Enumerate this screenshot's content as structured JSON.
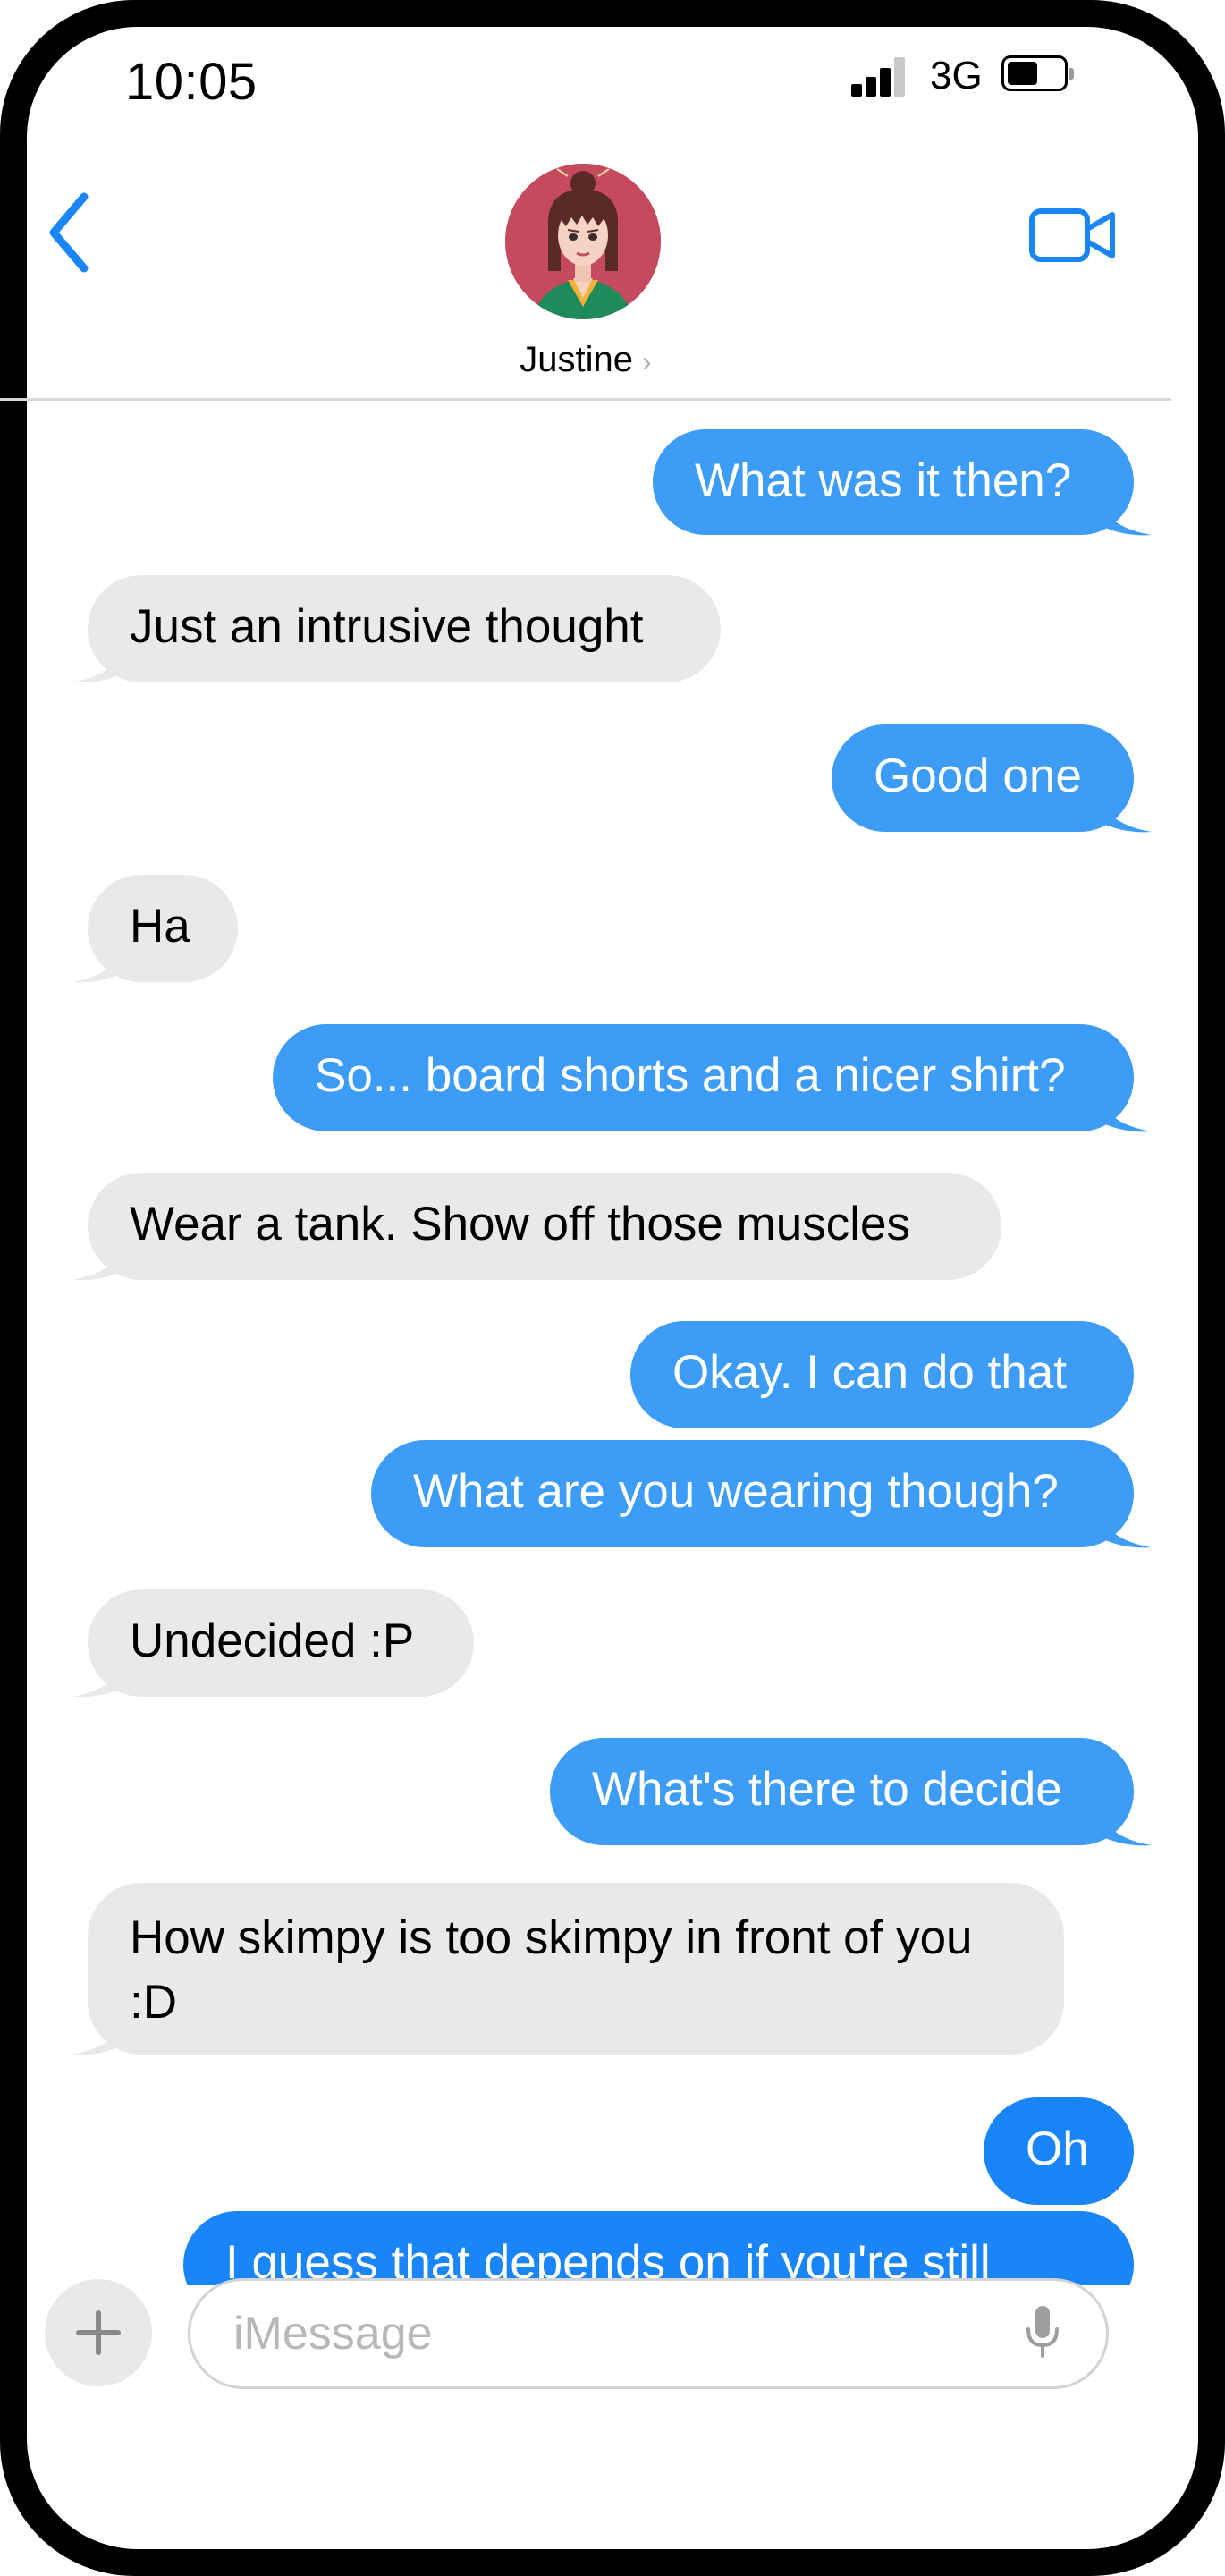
{
  "status_bar": {
    "time": "10:05",
    "network": "3G",
    "signal_bars": 3,
    "battery_level": 0.55
  },
  "header": {
    "contact_name": "Justine",
    "back_icon": "chevron-left-icon",
    "video_icon": "video-camera-icon",
    "accent_color": "#1a85f7"
  },
  "messages": [
    {
      "direction": "outgoing",
      "text": "What was it then?"
    },
    {
      "direction": "incoming",
      "text": "Just an intrusive thought"
    },
    {
      "direction": "outgoing",
      "text": "Good one"
    },
    {
      "direction": "incoming",
      "text": "Ha"
    },
    {
      "direction": "outgoing",
      "text": "So... board shorts and a nicer shirt?"
    },
    {
      "direction": "incoming",
      "text": "Wear a tank.  Show off those muscles"
    },
    {
      "direction": "outgoing",
      "text": "Okay.  I can do that"
    },
    {
      "direction": "outgoing",
      "text": "What are you wearing though?"
    },
    {
      "direction": "incoming",
      "text": "Undecided :P"
    },
    {
      "direction": "outgoing",
      "text": "What's there to decide"
    },
    {
      "direction": "incoming",
      "text": "How skimpy is too skimpy in front of you :D"
    },
    {
      "direction": "outgoing",
      "text": "Oh"
    },
    {
      "direction": "outgoing",
      "text": "I guess that depends on if you're still"
    }
  ],
  "composer": {
    "placeholder": "iMessage",
    "plus_icon": "plus-icon",
    "mic_icon": "microphone-icon"
  },
  "colors": {
    "incoming_bubble": "#e9e9eb",
    "outgoing_bubble": "#3d9cf5"
  }
}
